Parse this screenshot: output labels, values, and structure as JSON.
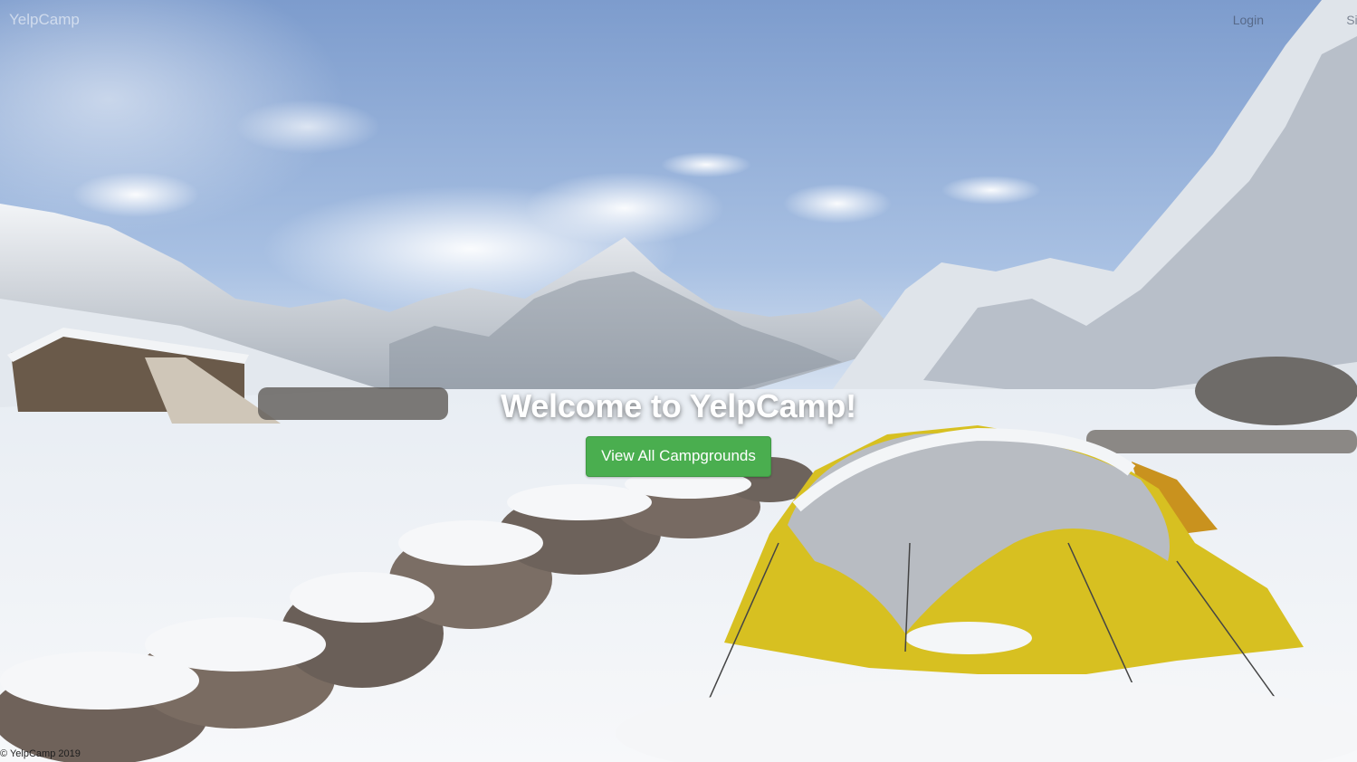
{
  "navbar": {
    "brand": "YelpCamp",
    "links": {
      "login": "Login",
      "signup": "Sign Up"
    }
  },
  "hero": {
    "title": "Welcome to YelpCamp!",
    "cta_label": "View All Campgrounds"
  },
  "footer": {
    "copyright": "© YelpCamp 2019"
  },
  "colors": {
    "cta_background": "#4aae4f",
    "hero_text": "#ffffff",
    "sky_top": "#7f9fcf",
    "snow": "#f4f6f9",
    "tent_yellow": "#d8c21f"
  }
}
